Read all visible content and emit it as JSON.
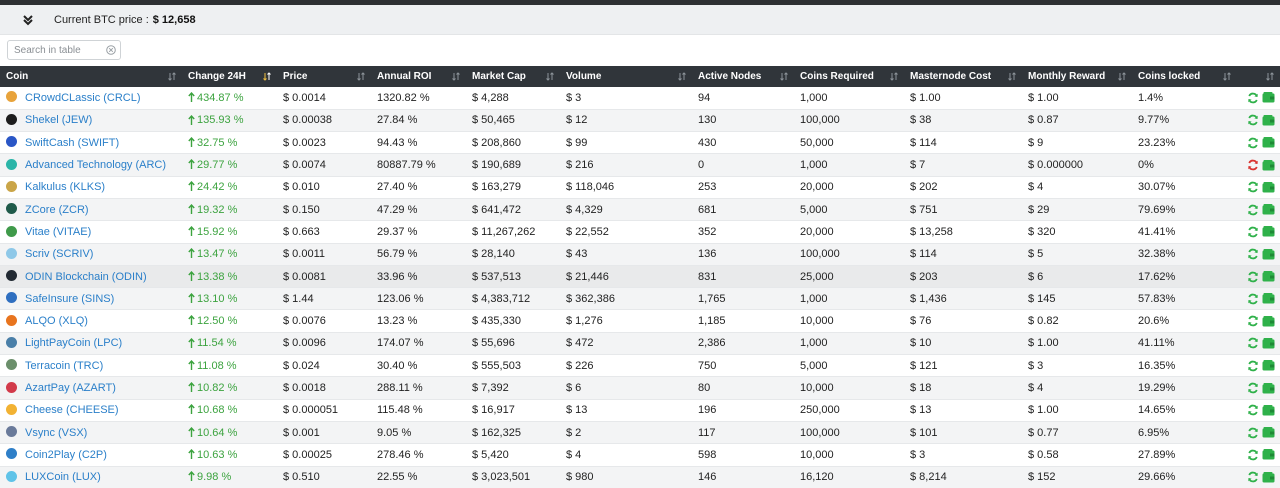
{
  "btc": {
    "label": "Current BTC price :",
    "value": "$ 12,658"
  },
  "search": {
    "placeholder": "Search in table"
  },
  "colors": {
    "header_bg": "#30353a",
    "link": "#2a7fc9",
    "up": "#3ca33f",
    "refresh": "#2fb14a",
    "refresh_alert": "#d9332f",
    "wallet": "#2fb14a"
  },
  "headers": [
    "Coin",
    "Change 24H",
    "Price",
    "Annual ROI",
    "Market Cap",
    "Volume",
    "Active Nodes",
    "Coins Required",
    "Masternode Cost",
    "Monthly Reward",
    "Coins locked"
  ],
  "rows": [
    {
      "coin": "CRowdCLassic (CRCL)",
      "icon": "crcl-icon",
      "icon_color": "#e8a33b",
      "change": "434.87 %",
      "price": "$ 0.0014",
      "roi": "1320.82 %",
      "mcap": "$ 4,288",
      "volume": "$ 3",
      "nodes": "94",
      "required": "1,000",
      "cost": "$ 1.00",
      "reward": "$ 1.00",
      "locked": "1.4%",
      "refresh": "ok"
    },
    {
      "coin": "Shekel (JEW)",
      "icon": "jew-icon",
      "icon_color": "#1d1d1d",
      "change": "135.93 %",
      "price": "$ 0.00038",
      "roi": "27.84 %",
      "mcap": "$ 50,465",
      "volume": "$ 12",
      "nodes": "130",
      "required": "100,000",
      "cost": "$ 38",
      "reward": "$ 0.87",
      "locked": "9.77%",
      "refresh": "ok"
    },
    {
      "coin": "SwiftCash (SWIFT)",
      "icon": "swift-icon",
      "icon_color": "#2a56c6",
      "change": "32.75 %",
      "price": "$ 0.0023",
      "roi": "94.43 %",
      "mcap": "$ 208,860",
      "volume": "$ 99",
      "nodes": "430",
      "required": "50,000",
      "cost": "$ 114",
      "reward": "$ 9",
      "locked": "23.23%",
      "refresh": "ok"
    },
    {
      "coin": "Advanced Technology (ARC)",
      "icon": "arc-icon",
      "icon_color": "#2bb5a8",
      "change": "29.77 %",
      "price": "$ 0.0074",
      "roi": "80887.79 %",
      "mcap": "$ 190,689",
      "volume": "$ 216",
      "nodes": "0",
      "required": "1,000",
      "cost": "$ 7",
      "reward": "$ 0.000000",
      "locked": "0%",
      "refresh": "alert"
    },
    {
      "coin": "Kalkulus (KLKS)",
      "icon": "klks-icon",
      "icon_color": "#caa548",
      "change": "24.42 %",
      "price": "$ 0.010",
      "roi": "27.40 %",
      "mcap": "$ 163,279",
      "volume": "$ 118,046",
      "nodes": "253",
      "required": "20,000",
      "cost": "$ 202",
      "reward": "$ 4",
      "locked": "30.07%",
      "refresh": "ok"
    },
    {
      "coin": "ZCore (ZCR)",
      "icon": "zcr-icon",
      "icon_color": "#1f5a4a",
      "change": "19.32 %",
      "price": "$ 0.150",
      "roi": "47.29 %",
      "mcap": "$ 641,472",
      "volume": "$ 4,329",
      "nodes": "681",
      "required": "5,000",
      "cost": "$ 751",
      "reward": "$ 29",
      "locked": "79.69%",
      "refresh": "ok"
    },
    {
      "coin": "Vitae (VITAE)",
      "icon": "vitae-icon",
      "icon_color": "#3f9a4a",
      "change": "15.92 %",
      "price": "$ 0.663",
      "roi": "29.37 %",
      "mcap": "$ 11,267,262",
      "volume": "$ 22,552",
      "nodes": "352",
      "required": "20,000",
      "cost": "$ 13,258",
      "reward": "$ 320",
      "locked": "41.41%",
      "refresh": "ok"
    },
    {
      "coin": "Scriv (SCRIV)",
      "icon": "scriv-icon",
      "icon_color": "#8ec8e8",
      "change": "13.47 %",
      "price": "$ 0.0011",
      "roi": "56.79 %",
      "mcap": "$ 28,140",
      "volume": "$ 43",
      "nodes": "136",
      "required": "100,000",
      "cost": "$ 114",
      "reward": "$ 5",
      "locked": "32.38%",
      "refresh": "ok"
    },
    {
      "coin": "ODIN Blockchain (ODIN)",
      "icon": "odin-icon",
      "icon_color": "#222a33",
      "change": "13.38 %",
      "price": "$ 0.0081",
      "roi": "33.96 %",
      "mcap": "$ 537,513",
      "volume": "$ 21,446",
      "nodes": "831",
      "required": "25,000",
      "cost": "$ 203",
      "reward": "$ 6",
      "locked": "17.62%",
      "refresh": "ok"
    },
    {
      "coin": "SafeInsure (SINS)",
      "icon": "sins-icon",
      "icon_color": "#2f6fc0",
      "change": "13.10 %",
      "price": "$ 1.44",
      "roi": "123.06 %",
      "mcap": "$ 4,383,712",
      "volume": "$ 362,386",
      "nodes": "1,765",
      "required": "1,000",
      "cost": "$ 1,436",
      "reward": "$ 145",
      "locked": "57.83%",
      "refresh": "ok"
    },
    {
      "coin": "ALQO (XLQ)",
      "icon": "xlq-icon",
      "icon_color": "#e8741e",
      "change": "12.50 %",
      "price": "$ 0.0076",
      "roi": "13.23 %",
      "mcap": "$ 435,330",
      "volume": "$ 1,276",
      "nodes": "1,185",
      "required": "10,000",
      "cost": "$ 76",
      "reward": "$ 0.82",
      "locked": "20.6%",
      "refresh": "ok"
    },
    {
      "coin": "LightPayCoin (LPC)",
      "icon": "lpc-icon",
      "icon_color": "#4a7fa8",
      "change": "11.54 %",
      "price": "$ 0.0096",
      "roi": "174.07 %",
      "mcap": "$ 55,696",
      "volume": "$ 472",
      "nodes": "2,386",
      "required": "1,000",
      "cost": "$ 10",
      "reward": "$ 1.00",
      "locked": "41.11%",
      "refresh": "ok"
    },
    {
      "coin": "Terracoin (TRC)",
      "icon": "trc-icon",
      "icon_color": "#6b8f6b",
      "change": "11.08 %",
      "price": "$ 0.024",
      "roi": "30.40 %",
      "mcap": "$ 555,503",
      "volume": "$ 226",
      "nodes": "750",
      "required": "5,000",
      "cost": "$ 121",
      "reward": "$ 3",
      "locked": "16.35%",
      "refresh": "ok"
    },
    {
      "coin": "AzartPay (AZART)",
      "icon": "azart-icon",
      "icon_color": "#d23a4a",
      "change": "10.82 %",
      "price": "$ 0.0018",
      "roi": "288.11 %",
      "mcap": "$ 7,392",
      "volume": "$ 6",
      "nodes": "80",
      "required": "10,000",
      "cost": "$ 18",
      "reward": "$ 4",
      "locked": "19.29%",
      "refresh": "ok"
    },
    {
      "coin": "Cheese (CHEESE)",
      "icon": "cheese-icon",
      "icon_color": "#f2b233",
      "change": "10.68 %",
      "price": "$ 0.000051",
      "roi": "115.48 %",
      "mcap": "$ 16,917",
      "volume": "$ 13",
      "nodes": "196",
      "required": "250,000",
      "cost": "$ 13",
      "reward": "$ 1.00",
      "locked": "14.65%",
      "refresh": "ok"
    },
    {
      "coin": "Vsync (VSX)",
      "icon": "vsx-icon",
      "icon_color": "#6a7a9a",
      "change": "10.64 %",
      "price": "$ 0.001",
      "roi": "9.05 %",
      "mcap": "$ 162,325",
      "volume": "$ 2",
      "nodes": "117",
      "required": "100,000",
      "cost": "$ 101",
      "reward": "$ 0.77",
      "locked": "6.95%",
      "refresh": "ok"
    },
    {
      "coin": "Coin2Play (C2P)",
      "icon": "c2p-icon",
      "icon_color": "#2f7fc8",
      "change": "10.63 %",
      "price": "$ 0.00025",
      "roi": "278.46 %",
      "mcap": "$ 5,420",
      "volume": "$ 4",
      "nodes": "598",
      "required": "10,000",
      "cost": "$ 3",
      "reward": "$ 0.58",
      "locked": "27.89%",
      "refresh": "ok"
    },
    {
      "coin": "LUXCoin (LUX)",
      "icon": "lux-icon",
      "icon_color": "#5fc3e8",
      "change": "9.98 %",
      "price": "$ 0.510",
      "roi": "22.55 %",
      "mcap": "$ 3,023,501",
      "volume": "$ 980",
      "nodes": "146",
      "required": "16,120",
      "cost": "$ 8,214",
      "reward": "$ 152",
      "locked": "29.66%",
      "refresh": "ok"
    }
  ]
}
